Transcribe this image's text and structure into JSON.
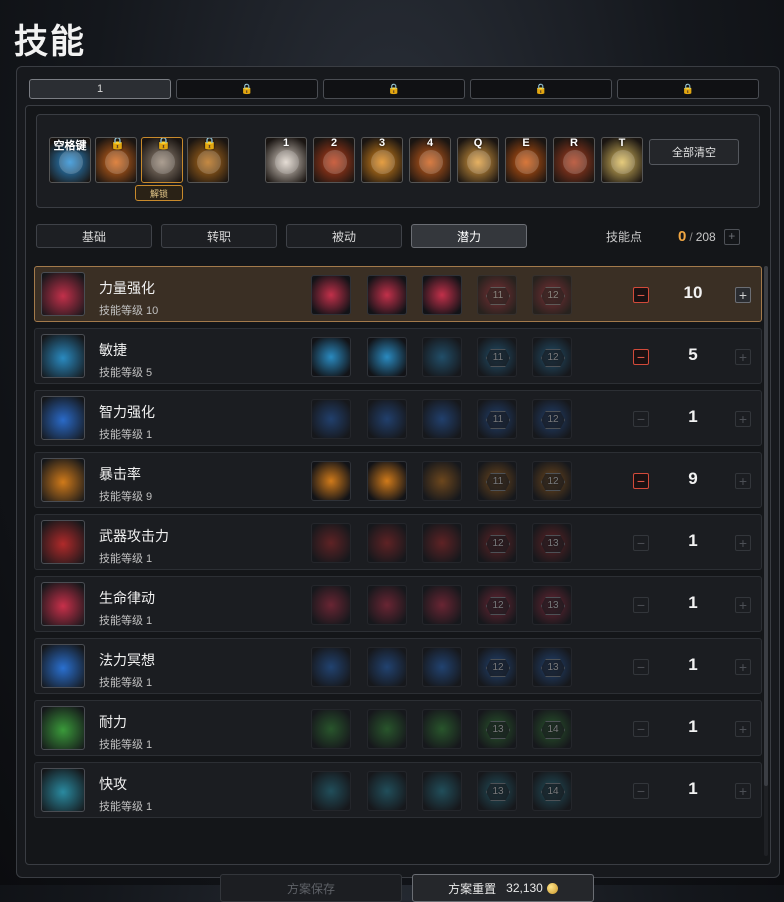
{
  "page": {
    "title": "技能"
  },
  "preset_tabs": [
    {
      "label": "1",
      "locked": false,
      "active": true
    },
    {
      "label": "",
      "locked": true
    },
    {
      "label": "",
      "locked": true
    },
    {
      "label": "",
      "locked": true
    },
    {
      "label": "",
      "locked": true
    }
  ],
  "hotbar": {
    "slots": [
      {
        "key": "空格键",
        "icon": "dash-silhouette-icon",
        "color": "#2a8fd6"
      },
      {
        "key": "",
        "icon": "gate-skill-icon",
        "color": "#d86a1a",
        "lock": true
      },
      {
        "key": "",
        "icon": "claw-slash-icon",
        "color": "#9a8a7a",
        "lock": true
      },
      {
        "key": "",
        "icon": "pentagram-icon",
        "color": "#b8701a",
        "lock": true
      },
      {
        "key": "1",
        "icon": "white-mask-icon",
        "color": "#e0d6cc"
      },
      {
        "key": "2",
        "icon": "flame-orb-icon",
        "color": "#c0401a"
      },
      {
        "key": "3",
        "icon": "flame-wing-icon",
        "color": "#e08a1a"
      },
      {
        "key": "4",
        "icon": "fire-burst-icon",
        "color": "#d0601a"
      },
      {
        "key": "Q",
        "icon": "flame-slash-icon",
        "color": "#e0a040"
      },
      {
        "key": "E",
        "icon": "crescent-fire-icon",
        "color": "#d05a10"
      },
      {
        "key": "R",
        "icon": "ring-blade-icon",
        "color": "#b04020"
      },
      {
        "key": "T",
        "icon": "golden-slash-icon",
        "color": "#e0c060"
      }
    ],
    "unlock_label": "解锁",
    "clear_all_label": "全部清空"
  },
  "categories": [
    {
      "label": "基础",
      "active": false
    },
    {
      "label": "转职",
      "active": false
    },
    {
      "label": "被动",
      "active": false
    },
    {
      "label": "潜力",
      "active": true
    }
  ],
  "skill_points": {
    "label": "技能点",
    "used": "0",
    "total": "208",
    "plus": "+"
  },
  "skills": [
    {
      "name": "力量强化",
      "level_text": "技能等级 10",
      "value": "10",
      "selected": true,
      "minus_active": true,
      "plus_active": true,
      "icon": "fist-icon",
      "color": "#c2304a",
      "tiers": [
        {
          "req": "",
          "lit": true
        },
        {
          "req": "",
          "lit": true
        },
        {
          "req": "",
          "lit": true
        },
        {
          "req": "11",
          "lit": false
        },
        {
          "req": "12",
          "lit": false
        }
      ]
    },
    {
      "name": "敏捷",
      "level_text": "技能等级 5",
      "value": "5",
      "selected": false,
      "minus_active": true,
      "plus_active": false,
      "icon": "agility-figure-icon",
      "color": "#2a8ac0",
      "tiers": [
        {
          "req": "",
          "lit": true
        },
        {
          "req": "",
          "lit": true
        },
        {
          "req": "",
          "lit": false
        },
        {
          "req": "11",
          "lit": false
        },
        {
          "req": "12",
          "lit": false
        }
      ]
    },
    {
      "name": "智力强化",
      "level_text": "技能等级 1",
      "value": "1",
      "selected": false,
      "minus_active": false,
      "plus_active": false,
      "icon": "mind-head-icon",
      "color": "#2a6ac8",
      "tiers": [
        {
          "req": "",
          "lit": false
        },
        {
          "req": "",
          "lit": false
        },
        {
          "req": "",
          "lit": false
        },
        {
          "req": "11",
          "lit": false
        },
        {
          "req": "12",
          "lit": false
        }
      ]
    },
    {
      "name": "暴击率",
      "level_text": "技能等级 9",
      "value": "9",
      "selected": false,
      "minus_active": true,
      "plus_active": false,
      "icon": "punch-icon",
      "color": "#d07a1a",
      "tiers": [
        {
          "req": "",
          "lit": true
        },
        {
          "req": "",
          "lit": true
        },
        {
          "req": "",
          "lit": false
        },
        {
          "req": "11",
          "lit": false
        },
        {
          "req": "12",
          "lit": false
        }
      ]
    },
    {
      "name": "武器攻击力",
      "level_text": "技能等级 1",
      "value": "1",
      "selected": false,
      "minus_active": false,
      "plus_active": false,
      "icon": "weapon-slash-icon",
      "color": "#b02a2a",
      "tiers": [
        {
          "req": "",
          "lit": false
        },
        {
          "req": "",
          "lit": false
        },
        {
          "req": "",
          "lit": false
        },
        {
          "req": "12",
          "lit": false
        },
        {
          "req": "13",
          "lit": false
        }
      ]
    },
    {
      "name": "生命律动",
      "level_text": "技能等级 1",
      "value": "1",
      "selected": false,
      "minus_active": false,
      "plus_active": false,
      "icon": "life-orb-icon",
      "color": "#c8304a",
      "tiers": [
        {
          "req": "",
          "lit": false
        },
        {
          "req": "",
          "lit": false
        },
        {
          "req": "",
          "lit": false
        },
        {
          "req": "12",
          "lit": false
        },
        {
          "req": "13",
          "lit": false
        }
      ]
    },
    {
      "name": "法力冥想",
      "level_text": "技能等级 1",
      "value": "1",
      "selected": false,
      "minus_active": false,
      "plus_active": false,
      "icon": "mana-orb-icon",
      "color": "#2a70d0",
      "tiers": [
        {
          "req": "",
          "lit": false
        },
        {
          "req": "",
          "lit": false
        },
        {
          "req": "",
          "lit": false
        },
        {
          "req": "12",
          "lit": false
        },
        {
          "req": "13",
          "lit": false
        }
      ]
    },
    {
      "name": "耐力",
      "level_text": "技能等级 1",
      "value": "1",
      "selected": false,
      "minus_active": false,
      "plus_active": false,
      "icon": "stamina-figure-icon",
      "color": "#3a9a3a",
      "tiers": [
        {
          "req": "",
          "lit": false
        },
        {
          "req": "",
          "lit": false
        },
        {
          "req": "",
          "lit": false
        },
        {
          "req": "13",
          "lit": false
        },
        {
          "req": "14",
          "lit": false
        }
      ]
    },
    {
      "name": "快攻",
      "level_text": "技能等级 1",
      "value": "1",
      "selected": false,
      "minus_active": false,
      "plus_active": false,
      "icon": "quick-attack-icon",
      "color": "#2a8aa0",
      "tiers": [
        {
          "req": "",
          "lit": false
        },
        {
          "req": "",
          "lit": false
        },
        {
          "req": "",
          "lit": false
        },
        {
          "req": "13",
          "lit": false
        },
        {
          "req": "14",
          "lit": false
        }
      ]
    }
  ],
  "footer": {
    "save_label": "方案保存",
    "reset_label": "方案重置",
    "reset_cost": "32,130"
  }
}
